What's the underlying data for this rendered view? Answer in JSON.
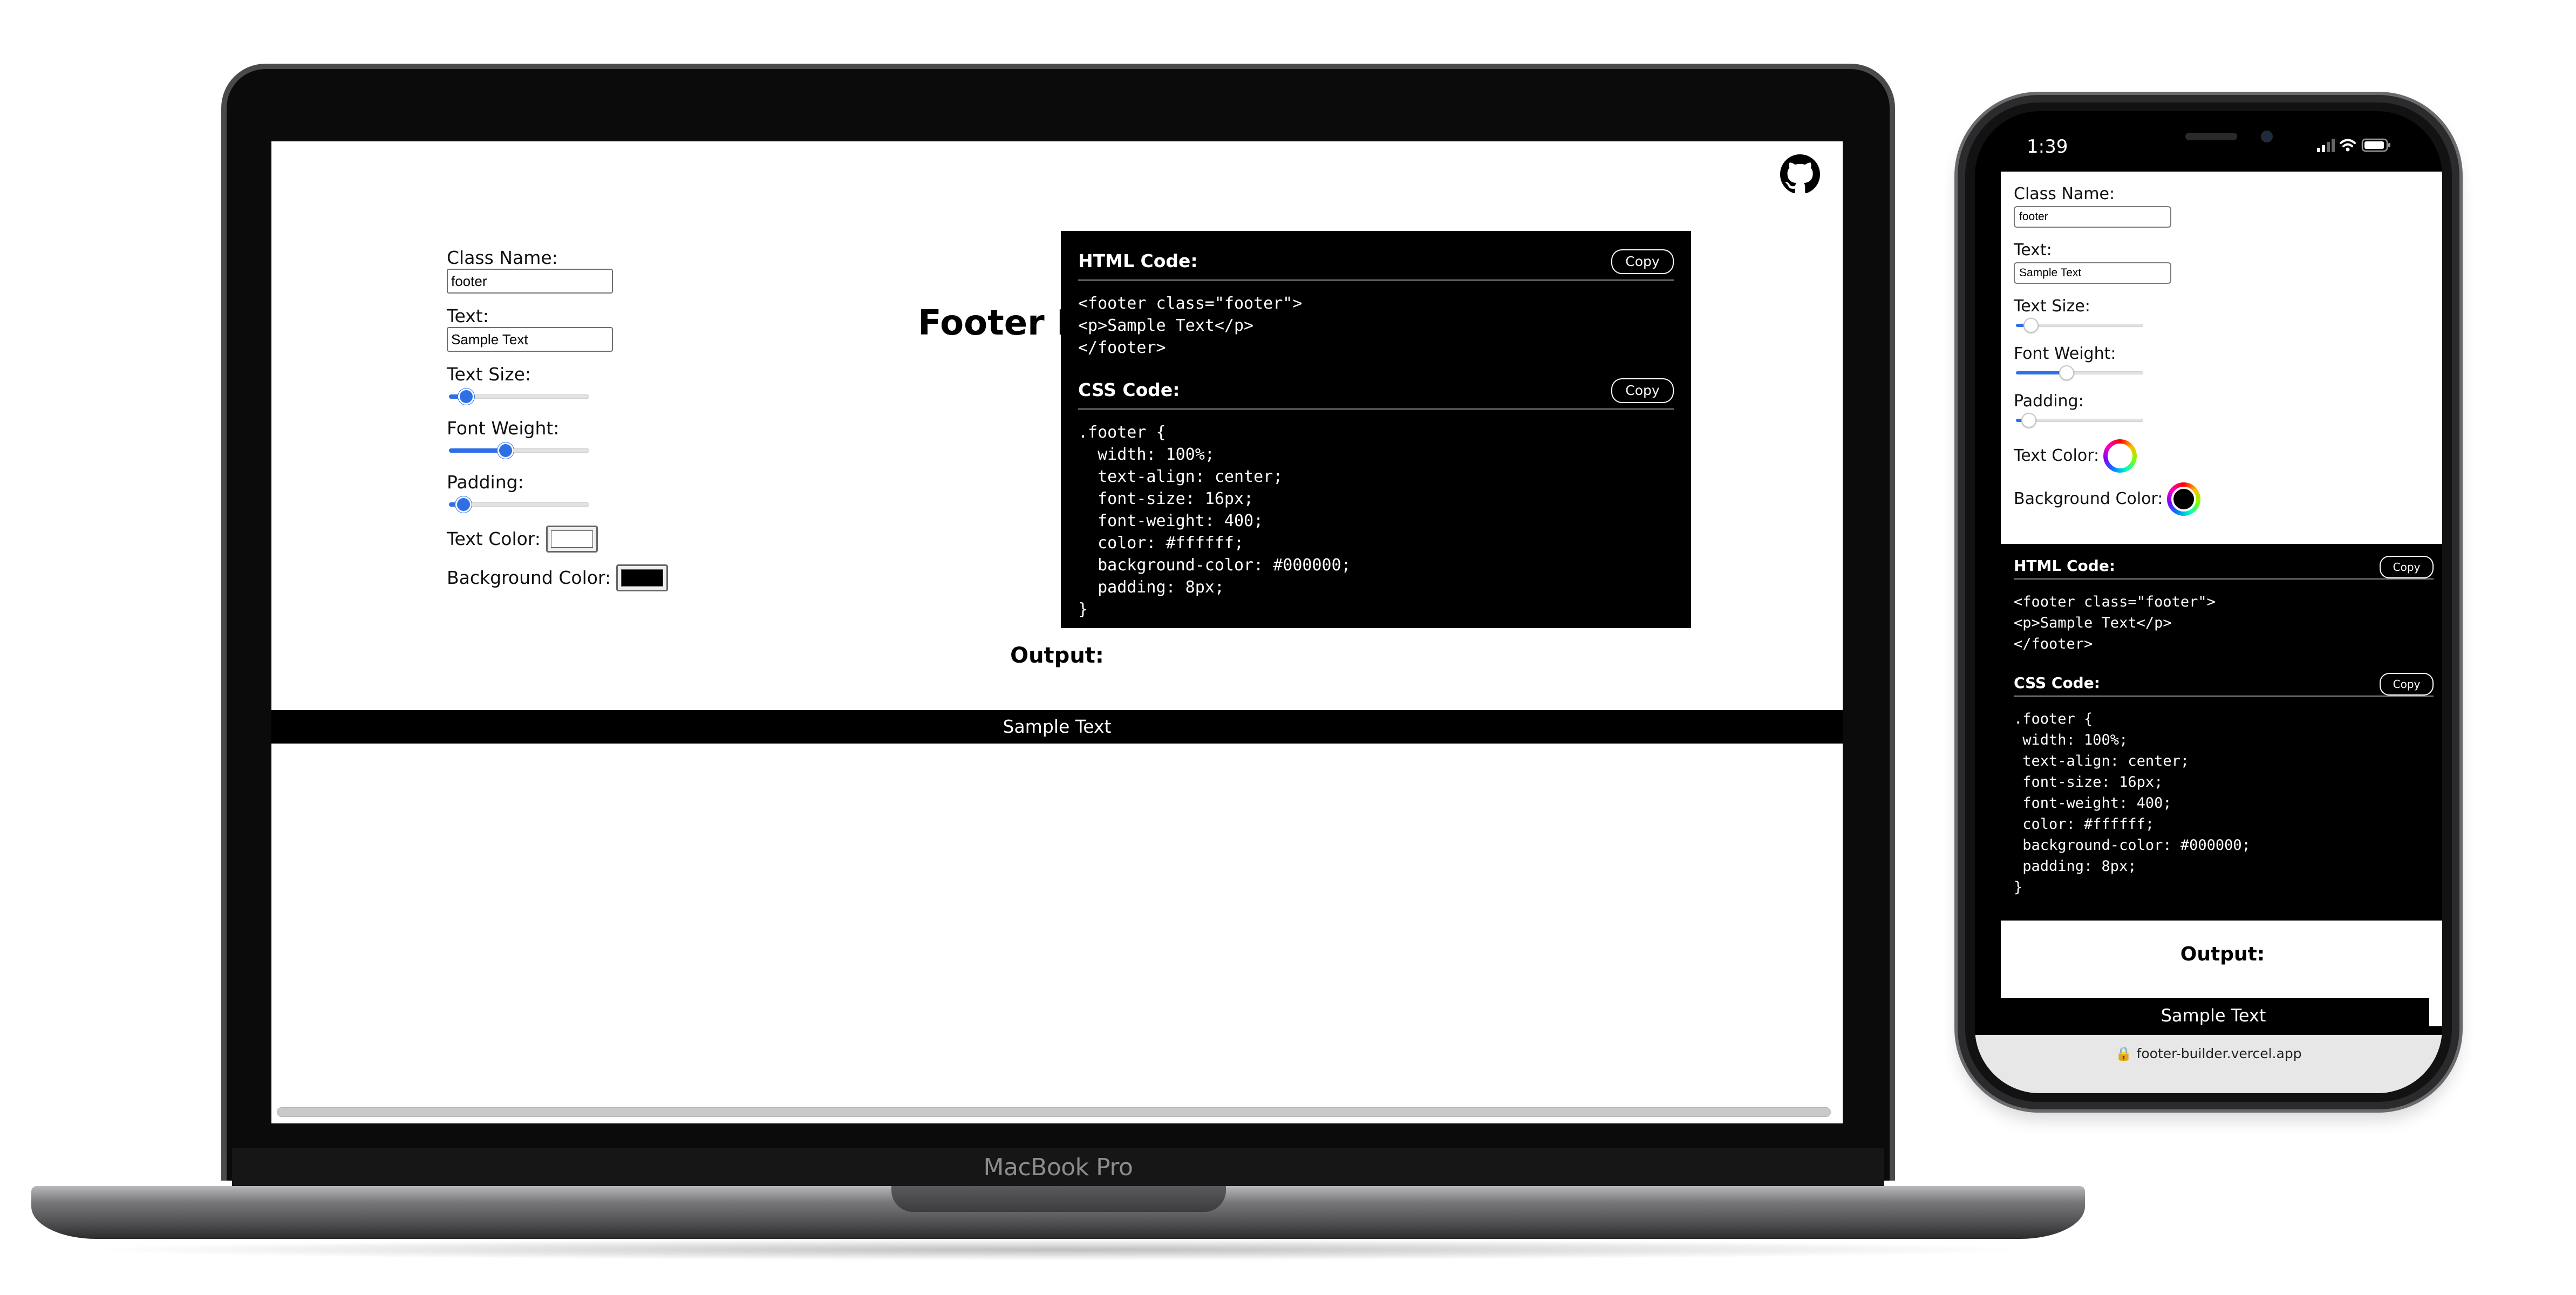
{
  "device_label": "MacBook Pro",
  "desktop": {
    "title": "Footer Builder",
    "controls": {
      "class_name_label": "Class Name:",
      "class_name_value": "footer",
      "text_label": "Text:",
      "text_value": "Sample Text",
      "text_size_label": "Text Size:",
      "text_size_level": 0.12,
      "font_weight_label": "Font Weight:",
      "font_weight_level": 0.4,
      "padding_label": "Padding:",
      "padding_level": 0.1,
      "text_color_label": "Text Color:",
      "text_color_value": "#ffffff",
      "bg_color_label": "Background Color:",
      "bg_color_value": "#000000"
    },
    "html_code": {
      "heading": "HTML Code:",
      "copy_label": "Copy",
      "code": "<footer class=\"footer\">\n<p>Sample Text</p>\n</footer>"
    },
    "css_code": {
      "heading": "CSS Code:",
      "copy_label": "Copy",
      "code": ".footer {\n  width: 100%;\n  text-align: center;\n  font-size: 16px;\n  font-weight: 400;\n  color: #ffffff;\n  background-color: #000000;\n  padding: 8px;\n}"
    },
    "output_label": "Output:",
    "footer_preview_text": "Sample Text"
  },
  "mobile": {
    "status_time": "1:39",
    "controls": {
      "class_name_label": "Class Name:",
      "class_name_value": "footer",
      "text_label": "Text:",
      "text_value": "Sample Text",
      "text_size_label": "Text Size:",
      "font_weight_label": "Font Weight:",
      "padding_label": "Padding:",
      "text_color_label": "Text Color:",
      "bg_color_label": "Background Color:"
    },
    "html_code": {
      "heading": "HTML Code:",
      "copy_label": "Copy",
      "code": "<footer class=\"footer\">\n<p>Sample Text</p>\n</footer>"
    },
    "css_code": {
      "heading": "CSS Code:",
      "copy_label": "Copy",
      "code": ".footer {\n width: 100%;\n text-align: center;\n font-size: 16px;\n font-weight: 400;\n color: #ffffff;\n background-color: #000000;\n padding: 8px;\n}"
    },
    "output_label": "Output:",
    "footer_preview_text": "Sample Text",
    "url": "footer-builder.vercel.app"
  },
  "colors": {
    "accent": "#2f6fe6",
    "code_bg": "#000000",
    "page_bg": "#ffffff"
  },
  "icons": {
    "repo": "github-icon",
    "lock": "lock-icon"
  }
}
